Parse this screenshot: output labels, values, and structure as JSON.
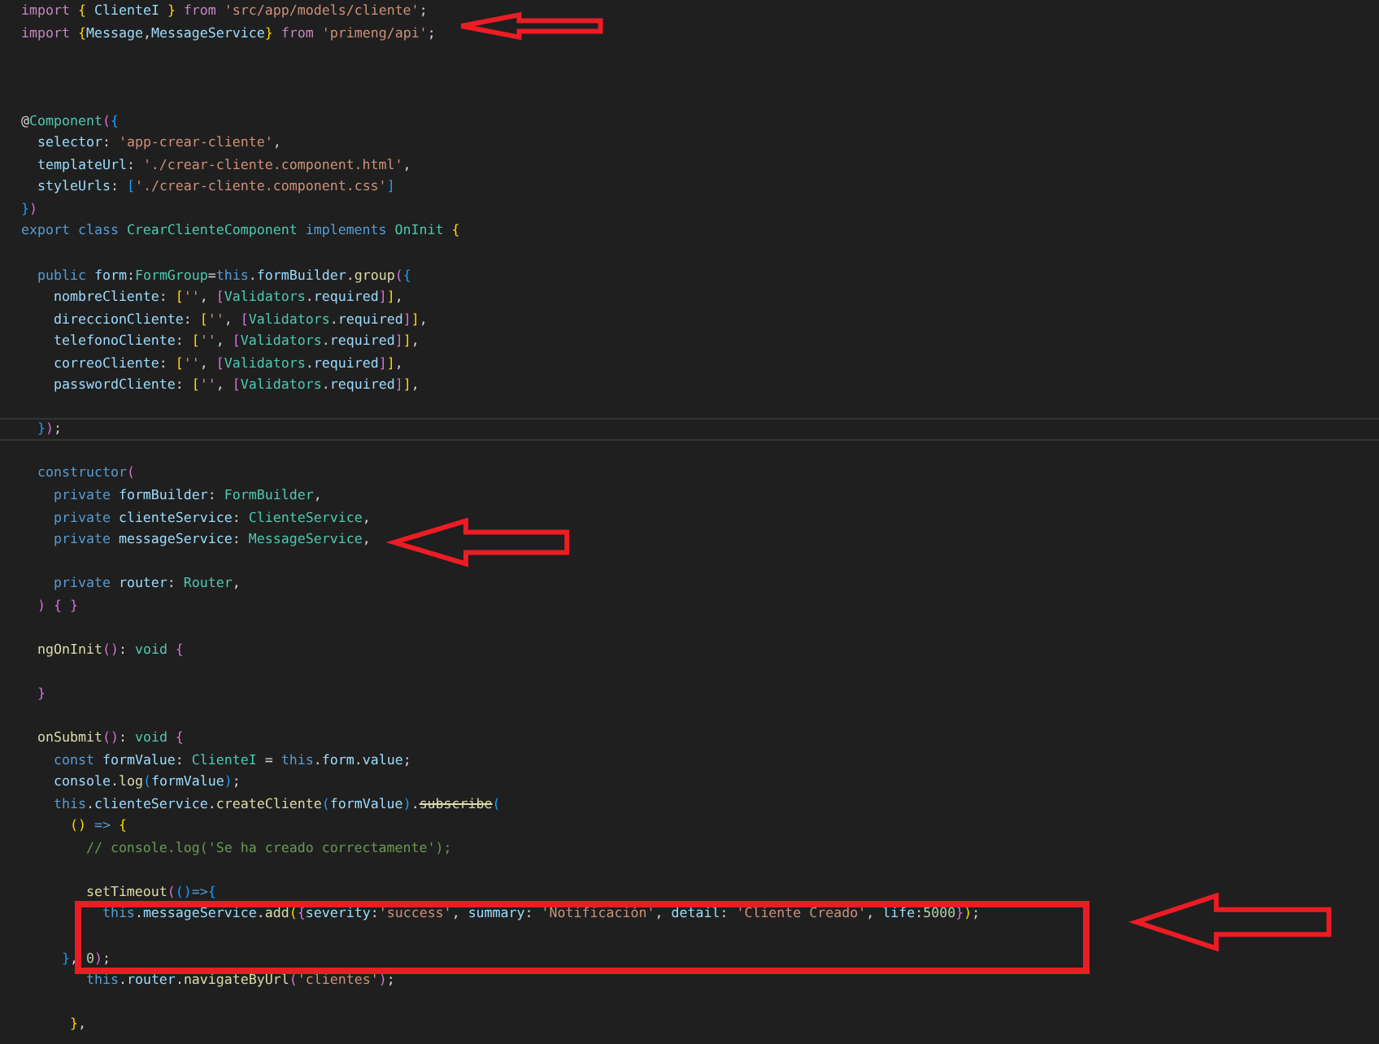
{
  "editor": {
    "lines": [
      {
        "kind": "code",
        "current": false,
        "tokens": [
          {
            "kind": "kw",
            "text": "import"
          },
          {
            "kind": "b1",
            "text": " {"
          },
          {
            "kind": "var",
            "text": " ClienteI "
          },
          {
            "kind": "b1",
            "text": "}"
          },
          {
            "kind": "kw",
            "text": " from"
          },
          {
            "kind": "str",
            "text": " 'src/app/models/cliente'"
          },
          {
            "kind": "punc",
            "text": ";"
          }
        ]
      },
      {
        "kind": "code",
        "current": false,
        "tokens": [
          {
            "kind": "kw",
            "text": "import"
          },
          {
            "kind": "b1",
            "text": " {"
          },
          {
            "kind": "var",
            "text": "Message"
          },
          {
            "kind": "punc",
            "text": ","
          },
          {
            "kind": "var",
            "text": "MessageService"
          },
          {
            "kind": "b1",
            "text": "}"
          },
          {
            "kind": "kw",
            "text": " from"
          },
          {
            "kind": "str",
            "text": " 'primeng/api'"
          },
          {
            "kind": "punc",
            "text": ";"
          }
        ]
      },
      {
        "kind": "blank"
      },
      {
        "kind": "blank"
      },
      {
        "kind": "blank"
      },
      {
        "kind": "code",
        "current": false,
        "tokens": [
          {
            "kind": "punc",
            "text": "@"
          },
          {
            "kind": "type",
            "text": "Component"
          },
          {
            "kind": "b2",
            "text": "("
          },
          {
            "kind": "b3",
            "text": "{"
          }
        ]
      },
      {
        "kind": "code",
        "current": false,
        "tokens": [
          {
            "kind": "var",
            "text": "  selector"
          },
          {
            "kind": "punc",
            "text": ": "
          },
          {
            "kind": "str",
            "text": "'app-crear-cliente'"
          },
          {
            "kind": "punc",
            "text": ","
          }
        ]
      },
      {
        "kind": "code",
        "current": false,
        "tokens": [
          {
            "kind": "var",
            "text": "  templateUrl"
          },
          {
            "kind": "punc",
            "text": ": "
          },
          {
            "kind": "str",
            "text": "'./crear-cliente.component.html'"
          },
          {
            "kind": "punc",
            "text": ","
          }
        ]
      },
      {
        "kind": "code",
        "current": false,
        "tokens": [
          {
            "kind": "var",
            "text": "  styleUrls"
          },
          {
            "kind": "punc",
            "text": ": "
          },
          {
            "kind": "b3",
            "text": "["
          },
          {
            "kind": "str",
            "text": "'./crear-cliente.component.css'"
          },
          {
            "kind": "b3",
            "text": "]"
          }
        ]
      },
      {
        "kind": "code",
        "current": false,
        "tokens": [
          {
            "kind": "b3",
            "text": "}"
          },
          {
            "kind": "b2",
            "text": ")"
          }
        ]
      },
      {
        "kind": "code",
        "current": false,
        "tokens": [
          {
            "kind": "st",
            "text": "export class "
          },
          {
            "kind": "type",
            "text": "CrearClienteComponent"
          },
          {
            "kind": "st",
            "text": " implements "
          },
          {
            "kind": "type",
            "text": "OnInit"
          },
          {
            "kind": "b1",
            "text": " {"
          }
        ]
      },
      {
        "kind": "blank"
      },
      {
        "kind": "code",
        "current": false,
        "tokens": [
          {
            "kind": "st",
            "text": "  public"
          },
          {
            "kind": "var",
            "text": " form"
          },
          {
            "kind": "punc",
            "text": ":"
          },
          {
            "kind": "type",
            "text": "FormGroup"
          },
          {
            "kind": "punc",
            "text": "="
          },
          {
            "kind": "st",
            "text": "this"
          },
          {
            "kind": "punc",
            "text": "."
          },
          {
            "kind": "var",
            "text": "formBuilder"
          },
          {
            "kind": "punc",
            "text": "."
          },
          {
            "kind": "fn",
            "text": "group"
          },
          {
            "kind": "b2",
            "text": "("
          },
          {
            "kind": "b3",
            "text": "{"
          }
        ]
      },
      {
        "kind": "code",
        "current": false,
        "tokens": [
          {
            "kind": "var",
            "text": "    nombreCliente"
          },
          {
            "kind": "punc",
            "text": ": "
          },
          {
            "kind": "b1",
            "text": "["
          },
          {
            "kind": "str",
            "text": "''"
          },
          {
            "kind": "punc",
            "text": ", "
          },
          {
            "kind": "b2",
            "text": "["
          },
          {
            "kind": "type",
            "text": "Validators"
          },
          {
            "kind": "punc",
            "text": "."
          },
          {
            "kind": "var",
            "text": "required"
          },
          {
            "kind": "b2",
            "text": "]"
          },
          {
            "kind": "b1",
            "text": "]"
          },
          {
            "kind": "punc",
            "text": ","
          }
        ]
      },
      {
        "kind": "code",
        "current": false,
        "tokens": [
          {
            "kind": "var",
            "text": "    direccionCliente"
          },
          {
            "kind": "punc",
            "text": ": "
          },
          {
            "kind": "b1",
            "text": "["
          },
          {
            "kind": "str",
            "text": "''"
          },
          {
            "kind": "punc",
            "text": ", "
          },
          {
            "kind": "b2",
            "text": "["
          },
          {
            "kind": "type",
            "text": "Validators"
          },
          {
            "kind": "punc",
            "text": "."
          },
          {
            "kind": "var",
            "text": "required"
          },
          {
            "kind": "b2",
            "text": "]"
          },
          {
            "kind": "b1",
            "text": "]"
          },
          {
            "kind": "punc",
            "text": ","
          }
        ]
      },
      {
        "kind": "code",
        "current": false,
        "tokens": [
          {
            "kind": "var",
            "text": "    telefonoCliente"
          },
          {
            "kind": "punc",
            "text": ": "
          },
          {
            "kind": "b1",
            "text": "["
          },
          {
            "kind": "str",
            "text": "''"
          },
          {
            "kind": "punc",
            "text": ", "
          },
          {
            "kind": "b2",
            "text": "["
          },
          {
            "kind": "type",
            "text": "Validators"
          },
          {
            "kind": "punc",
            "text": "."
          },
          {
            "kind": "var",
            "text": "required"
          },
          {
            "kind": "b2",
            "text": "]"
          },
          {
            "kind": "b1",
            "text": "]"
          },
          {
            "kind": "punc",
            "text": ","
          }
        ]
      },
      {
        "kind": "code",
        "current": false,
        "tokens": [
          {
            "kind": "var",
            "text": "    correoCliente"
          },
          {
            "kind": "punc",
            "text": ": "
          },
          {
            "kind": "b1",
            "text": "["
          },
          {
            "kind": "str",
            "text": "''"
          },
          {
            "kind": "punc",
            "text": ", "
          },
          {
            "kind": "b2",
            "text": "["
          },
          {
            "kind": "type",
            "text": "Validators"
          },
          {
            "kind": "punc",
            "text": "."
          },
          {
            "kind": "var",
            "text": "required"
          },
          {
            "kind": "b2",
            "text": "]"
          },
          {
            "kind": "b1",
            "text": "]"
          },
          {
            "kind": "punc",
            "text": ","
          }
        ]
      },
      {
        "kind": "code",
        "current": false,
        "tokens": [
          {
            "kind": "var",
            "text": "    passwordCliente"
          },
          {
            "kind": "punc",
            "text": ": "
          },
          {
            "kind": "b1",
            "text": "["
          },
          {
            "kind": "str",
            "text": "''"
          },
          {
            "kind": "punc",
            "text": ", "
          },
          {
            "kind": "b2",
            "text": "["
          },
          {
            "kind": "type",
            "text": "Validators"
          },
          {
            "kind": "punc",
            "text": "."
          },
          {
            "kind": "var",
            "text": "required"
          },
          {
            "kind": "b2",
            "text": "]"
          },
          {
            "kind": "b1",
            "text": "]"
          },
          {
            "kind": "punc",
            "text": ","
          }
        ]
      },
      {
        "kind": "blank"
      },
      {
        "kind": "code",
        "current": true,
        "tokens": [
          {
            "kind": "b3",
            "text": "  }"
          },
          {
            "kind": "b2",
            "text": ")"
          },
          {
            "kind": "punc",
            "text": ";"
          }
        ]
      },
      {
        "kind": "blank"
      },
      {
        "kind": "code",
        "current": false,
        "tokens": [
          {
            "kind": "st",
            "text": "  constructor"
          },
          {
            "kind": "b2",
            "text": "("
          }
        ]
      },
      {
        "kind": "code",
        "current": false,
        "tokens": [
          {
            "kind": "st",
            "text": "    private"
          },
          {
            "kind": "var",
            "text": " formBuilder"
          },
          {
            "kind": "punc",
            "text": ": "
          },
          {
            "kind": "type",
            "text": "FormBuilder"
          },
          {
            "kind": "punc",
            "text": ","
          }
        ]
      },
      {
        "kind": "code",
        "current": false,
        "tokens": [
          {
            "kind": "st",
            "text": "    private"
          },
          {
            "kind": "var",
            "text": " clienteService"
          },
          {
            "kind": "punc",
            "text": ": "
          },
          {
            "kind": "type",
            "text": "ClienteService"
          },
          {
            "kind": "punc",
            "text": ","
          }
        ]
      },
      {
        "kind": "code",
        "current": false,
        "tokens": [
          {
            "kind": "st",
            "text": "    private"
          },
          {
            "kind": "var",
            "text": " messageService"
          },
          {
            "kind": "punc",
            "text": ": "
          },
          {
            "kind": "type",
            "text": "MessageService"
          },
          {
            "kind": "punc",
            "text": ","
          }
        ]
      },
      {
        "kind": "blank"
      },
      {
        "kind": "code",
        "current": false,
        "tokens": [
          {
            "kind": "st",
            "text": "    private"
          },
          {
            "kind": "var",
            "text": " router"
          },
          {
            "kind": "punc",
            "text": ": "
          },
          {
            "kind": "type",
            "text": "Router"
          },
          {
            "kind": "punc",
            "text": ","
          }
        ]
      },
      {
        "kind": "code",
        "current": false,
        "tokens": [
          {
            "kind": "b2",
            "text": "  ) { }"
          }
        ]
      },
      {
        "kind": "blank"
      },
      {
        "kind": "code",
        "current": false,
        "tokens": [
          {
            "kind": "fn",
            "text": "  ngOnInit"
          },
          {
            "kind": "b2",
            "text": "()"
          },
          {
            "kind": "punc",
            "text": ": "
          },
          {
            "kind": "type",
            "text": "void"
          },
          {
            "kind": "b2",
            "text": " {"
          }
        ]
      },
      {
        "kind": "blank"
      },
      {
        "kind": "code",
        "current": false,
        "tokens": [
          {
            "kind": "b2",
            "text": "  }"
          }
        ]
      },
      {
        "kind": "blank"
      },
      {
        "kind": "code",
        "current": false,
        "tokens": [
          {
            "kind": "fn",
            "text": "  onSubmit"
          },
          {
            "kind": "b2",
            "text": "()"
          },
          {
            "kind": "punc",
            "text": ": "
          },
          {
            "kind": "type",
            "text": "void"
          },
          {
            "kind": "b2",
            "text": " {"
          }
        ]
      },
      {
        "kind": "code",
        "current": false,
        "tokens": [
          {
            "kind": "st",
            "text": "    const"
          },
          {
            "kind": "var",
            "text": " formValue"
          },
          {
            "kind": "punc",
            "text": ": "
          },
          {
            "kind": "type",
            "text": "ClienteI"
          },
          {
            "kind": "punc",
            "text": " = "
          },
          {
            "kind": "st",
            "text": "this"
          },
          {
            "kind": "punc",
            "text": "."
          },
          {
            "kind": "var",
            "text": "form"
          },
          {
            "kind": "punc",
            "text": "."
          },
          {
            "kind": "var",
            "text": "value"
          },
          {
            "kind": "punc",
            "text": ";"
          }
        ]
      },
      {
        "kind": "code",
        "current": false,
        "tokens": [
          {
            "kind": "var",
            "text": "    console"
          },
          {
            "kind": "punc",
            "text": "."
          },
          {
            "kind": "fn",
            "text": "log"
          },
          {
            "kind": "b3",
            "text": "("
          },
          {
            "kind": "var",
            "text": "formValue"
          },
          {
            "kind": "b3",
            "text": ")"
          },
          {
            "kind": "punc",
            "text": ";"
          }
        ]
      },
      {
        "kind": "code",
        "current": false,
        "tokens": [
          {
            "kind": "st",
            "text": "    this"
          },
          {
            "kind": "punc",
            "text": "."
          },
          {
            "kind": "var",
            "text": "clienteService"
          },
          {
            "kind": "punc",
            "text": "."
          },
          {
            "kind": "fn",
            "text": "createCliente"
          },
          {
            "kind": "b3",
            "text": "("
          },
          {
            "kind": "var",
            "text": "formValue"
          },
          {
            "kind": "b3",
            "text": ")"
          },
          {
            "kind": "punc",
            "text": "."
          },
          {
            "kind": "deprecated",
            "text": "subscribe"
          },
          {
            "kind": "b3",
            "text": "("
          }
        ]
      },
      {
        "kind": "code",
        "current": false,
        "tokens": [
          {
            "kind": "b1",
            "text": "      ()"
          },
          {
            "kind": "st",
            "text": " =>"
          },
          {
            "kind": "b1",
            "text": " {"
          }
        ]
      },
      {
        "kind": "code",
        "current": false,
        "tokens": [
          {
            "kind": "com",
            "text": "        // console.log('Se ha creado correctamente');"
          }
        ]
      },
      {
        "kind": "blank"
      },
      {
        "kind": "code",
        "current": false,
        "tokens": [
          {
            "kind": "fn",
            "text": "        setTimeout"
          },
          {
            "kind": "b2",
            "text": "("
          },
          {
            "kind": "b3",
            "text": "()"
          },
          {
            "kind": "st",
            "text": "=>"
          },
          {
            "kind": "b3",
            "text": "{"
          }
        ]
      },
      {
        "kind": "code",
        "current": false,
        "tokens": [
          {
            "kind": "st",
            "text": "          this"
          },
          {
            "kind": "punc",
            "text": "."
          },
          {
            "kind": "var",
            "text": "messageService"
          },
          {
            "kind": "punc",
            "text": "."
          },
          {
            "kind": "fn",
            "text": "add"
          },
          {
            "kind": "b1",
            "text": "("
          },
          {
            "kind": "b2",
            "text": "{"
          },
          {
            "kind": "var",
            "text": "severity"
          },
          {
            "kind": "punc",
            "text": ":"
          },
          {
            "kind": "str",
            "text": "'success'"
          },
          {
            "kind": "punc",
            "text": ", "
          },
          {
            "kind": "var",
            "text": "summary"
          },
          {
            "kind": "punc",
            "text": ": "
          },
          {
            "kind": "str",
            "text": "'Notificación'"
          },
          {
            "kind": "punc",
            "text": ", "
          },
          {
            "kind": "var",
            "text": "detail"
          },
          {
            "kind": "punc",
            "text": ": "
          },
          {
            "kind": "str",
            "text": "'Cliente Creado'"
          },
          {
            "kind": "punc",
            "text": ", "
          },
          {
            "kind": "var",
            "text": "life"
          },
          {
            "kind": "punc",
            "text": ":"
          },
          {
            "kind": "num",
            "text": "5000"
          },
          {
            "kind": "b2",
            "text": "}"
          },
          {
            "kind": "b1",
            "text": ")"
          },
          {
            "kind": "punc",
            "text": ";"
          }
        ]
      },
      {
        "kind": "blank"
      },
      {
        "kind": "code",
        "current": false,
        "tokens": [
          {
            "kind": "b3",
            "text": "     }"
          },
          {
            "kind": "punc",
            "text": ", "
          },
          {
            "kind": "num",
            "text": "0"
          },
          {
            "kind": "b2",
            "text": ")"
          },
          {
            "kind": "punc",
            "text": ";"
          }
        ]
      },
      {
        "kind": "code",
        "current": false,
        "tokens": [
          {
            "kind": "st",
            "text": "        this"
          },
          {
            "kind": "punc",
            "text": "."
          },
          {
            "kind": "var",
            "text": "router"
          },
          {
            "kind": "punc",
            "text": "."
          },
          {
            "kind": "fn",
            "text": "navigateByUrl"
          },
          {
            "kind": "b2",
            "text": "("
          },
          {
            "kind": "str",
            "text": "'clientes'"
          },
          {
            "kind": "b2",
            "text": ")"
          },
          {
            "kind": "punc",
            "text": ";"
          }
        ]
      },
      {
        "kind": "blank"
      },
      {
        "kind": "code",
        "current": false,
        "tokens": [
          {
            "kind": "b1",
            "text": "      }"
          },
          {
            "kind": "punc",
            "text": ","
          }
        ]
      }
    ]
  },
  "annotations": [
    {
      "kind": "arrow"
    },
    {
      "kind": "arrow"
    },
    {
      "kind": "frame"
    },
    {
      "kind": "arrow"
    }
  ]
}
